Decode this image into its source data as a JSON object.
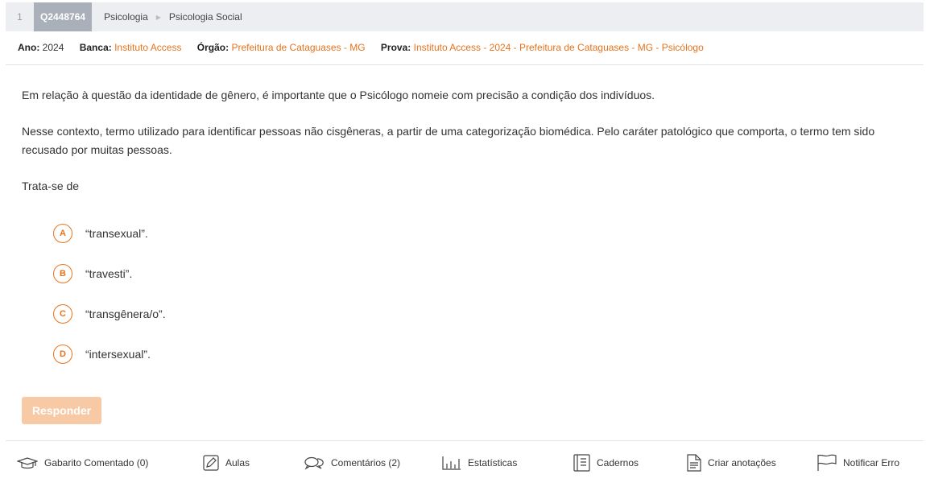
{
  "header": {
    "question_number": "1",
    "question_code": "Q2448764",
    "breadcrumb": [
      "Psicologia",
      "Psicologia Social"
    ]
  },
  "meta": {
    "ano_label": "Ano:",
    "ano_value": "2024",
    "banca_label": "Banca:",
    "banca_value": "Instituto Access",
    "orgao_label": "Órgão:",
    "orgao_value": "Prefeitura de Cataguases - MG",
    "prova_label": "Prova:",
    "prova_value": "Instituto Access - 2024 - Prefeitura de Cataguases - MG - Psicólogo"
  },
  "statement": {
    "p1": "Em relação à questão da identidade de gênero, é importante que o Psicólogo nomeie com precisão a condição dos indivíduos.",
    "p2": "Nesse contexto, termo utilizado para identificar pessoas não cisgêneras, a partir de uma categorização biomédica. Pelo caráter patológico que comporta, o termo tem sido recusado por muitas pessoas.",
    "p3": "Trata-se de"
  },
  "options": [
    {
      "letter": "A",
      "text": "“transexual”."
    },
    {
      "letter": "B",
      "text": "“travesti”."
    },
    {
      "letter": "C",
      "text": "“transgênera/o”."
    },
    {
      "letter": "D",
      "text": "“intersexual”."
    }
  ],
  "actions": {
    "responder_label": "Responder"
  },
  "footer": {
    "gabarito": "Gabarito Comentado (0)",
    "aulas": "Aulas",
    "comentarios": "Comentários (2)",
    "estatisticas": "Estatísticas",
    "cadernos": "Cadernos",
    "anotacoes": "Criar anotações",
    "notificar": "Notificar Erro"
  },
  "colors": {
    "accent": "#e8731c",
    "responder_disabled": "#f8c9a5",
    "header_bg": "#eceef1",
    "code_bg": "#a9b0b9"
  },
  "icons": {
    "gabarito": "graduation-cap-icon",
    "aulas": "pencil-icon",
    "comentarios": "chat-bubbles-icon",
    "estatisticas": "bar-chart-icon",
    "cadernos": "notebook-icon",
    "anotacoes": "document-icon",
    "notificar": "flag-icon"
  }
}
